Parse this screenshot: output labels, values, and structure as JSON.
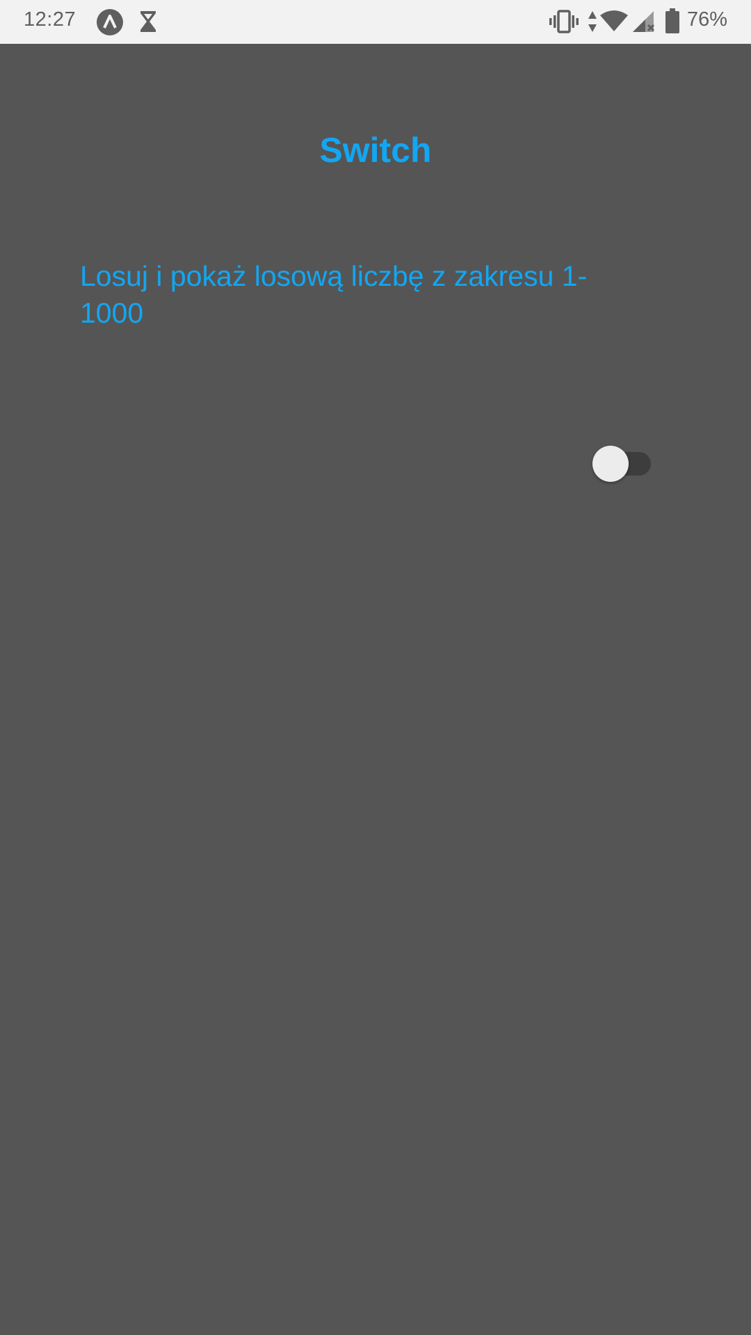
{
  "status_bar": {
    "time": "12:27",
    "battery_percent": "76%",
    "icons": [
      "app-a-icon",
      "hourglass-icon",
      "vibrate-icon",
      "data-arrows-icon",
      "wifi-icon",
      "signal-no-service-icon",
      "battery-icon"
    ]
  },
  "screen": {
    "title": "Switch",
    "description": "Losuj i pokaż losową liczbę z zakresu 1-1000",
    "switch": {
      "checked": false
    }
  },
  "colors": {
    "accent": "#13a6f2",
    "background": "#555555",
    "status_bar_bg": "#f2f2f2"
  }
}
